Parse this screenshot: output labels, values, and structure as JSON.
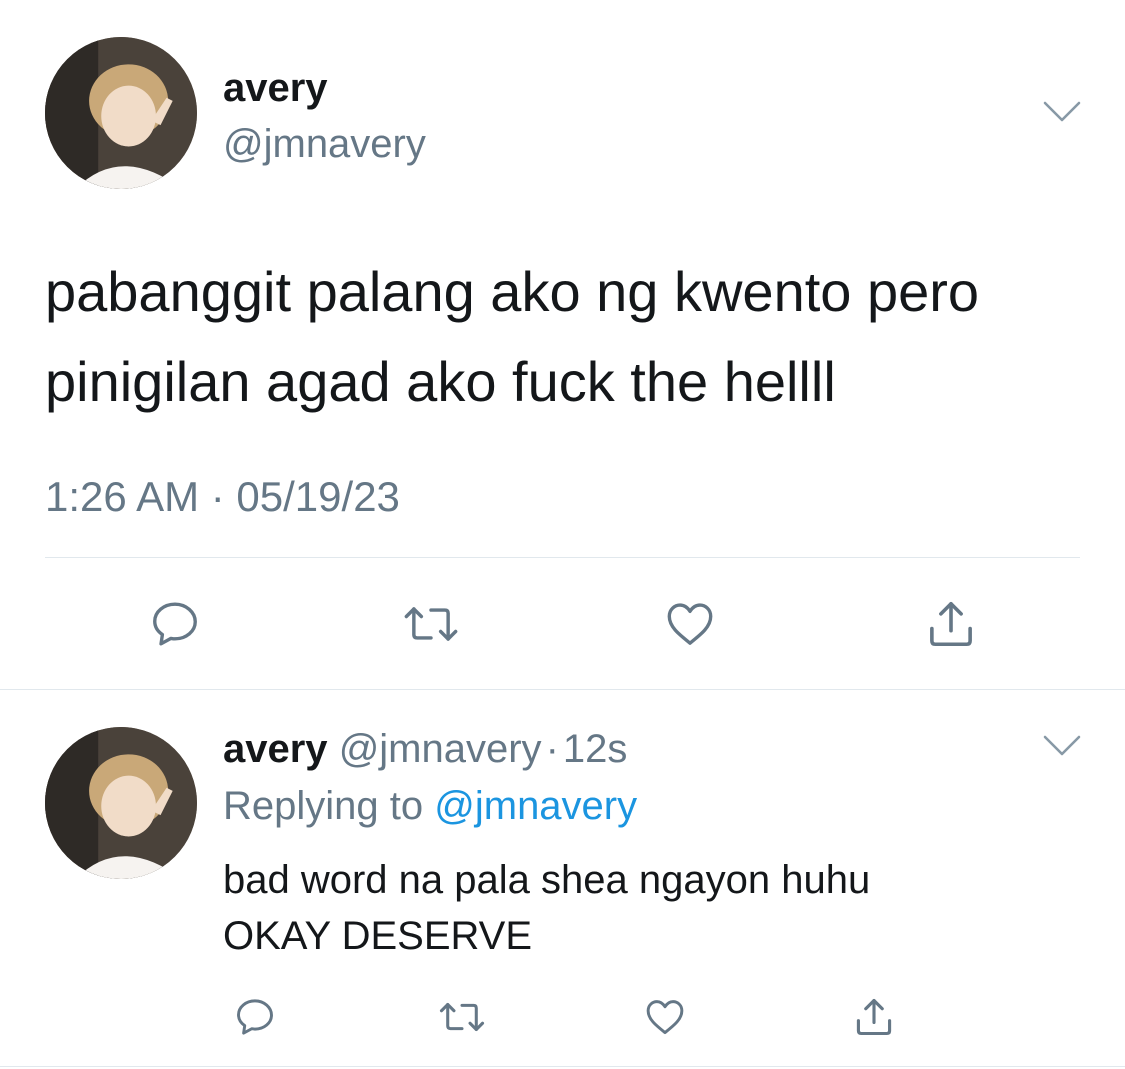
{
  "tweet": {
    "author_name": "avery",
    "author_handle": "@jmnavery",
    "text_line1": "pabanggit palang ako ng kwento pero",
    "text_line2": "pinigilan agad ako fuck the hellll",
    "timestamp": "1:26 AM · 05/19/23",
    "icons": [
      "reply-icon",
      "retweet-icon",
      "like-icon",
      "share-icon"
    ]
  },
  "reply": {
    "author_name": "avery",
    "author_handle": "@jmnavery",
    "dot": "·",
    "age": "12s",
    "replying_prefix": "Replying to",
    "replying_handle": "@jmnavery",
    "text_line1": "bad word na pala shea ngayon huhu",
    "text_line2": "OKAY DESERVE",
    "icons": [
      "reply-icon",
      "retweet-icon",
      "like-icon",
      "share-icon"
    ]
  },
  "colors": {
    "text": "#14171a",
    "muted": "#657786",
    "link": "#1b95e0",
    "divider": "#e1e8ed",
    "icon": "#657786"
  }
}
